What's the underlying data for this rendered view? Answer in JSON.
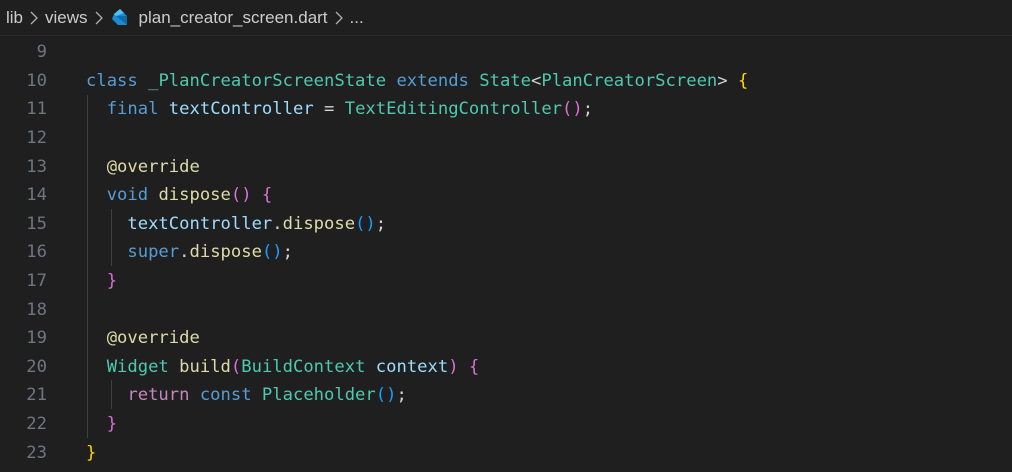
{
  "breadcrumb": {
    "items": [
      "lib",
      "views",
      "plan_creator_screen.dart",
      "..."
    ],
    "file_icon": "dart-icon"
  },
  "colors": {
    "background": "#1f1f1f",
    "line_number": "#6e7681",
    "keyword": "#569cd6",
    "type": "#4ec9b0",
    "variable": "#9cdcfe",
    "function": "#dcdcaa",
    "control": "#c586c0",
    "bracket_1": "#ffd700",
    "bracket_2": "#da70d6",
    "bracket_3": "#179fff"
  },
  "editor": {
    "lines": [
      {
        "number": "9",
        "tokens": []
      },
      {
        "number": "10",
        "tokens": [
          {
            "t": "class ",
            "c": "kw"
          },
          {
            "t": "_PlanCreatorScreenState ",
            "c": "ty"
          },
          {
            "t": "extends ",
            "c": "kw"
          },
          {
            "t": "State",
            "c": "ty"
          },
          {
            "t": "<",
            "c": "pl"
          },
          {
            "t": "PlanCreatorScreen",
            "c": "ty"
          },
          {
            "t": "> ",
            "c": "pl"
          },
          {
            "t": "{",
            "c": "b1"
          }
        ]
      },
      {
        "number": "11",
        "tokens": [
          {
            "t": "  final ",
            "c": "kw"
          },
          {
            "t": "textController",
            "c": "var"
          },
          {
            "t": " = ",
            "c": "pl"
          },
          {
            "t": "TextEditingController",
            "c": "ty"
          },
          {
            "t": "()",
            "c": "b2"
          },
          {
            "t": ";",
            "c": "pl"
          }
        ]
      },
      {
        "number": "12",
        "tokens": []
      },
      {
        "number": "13",
        "tokens": [
          {
            "t": "  @override",
            "c": "fn"
          }
        ]
      },
      {
        "number": "14",
        "tokens": [
          {
            "t": "  void ",
            "c": "kw"
          },
          {
            "t": "dispose",
            "c": "fn"
          },
          {
            "t": "() ",
            "c": "b2"
          },
          {
            "t": "{",
            "c": "b2"
          }
        ]
      },
      {
        "number": "15",
        "tokens": [
          {
            "t": "    textController",
            "c": "var"
          },
          {
            "t": ".",
            "c": "pl"
          },
          {
            "t": "dispose",
            "c": "fn"
          },
          {
            "t": "()",
            "c": "b3"
          },
          {
            "t": ";",
            "c": "pl"
          }
        ]
      },
      {
        "number": "16",
        "tokens": [
          {
            "t": "    super",
            "c": "kw"
          },
          {
            "t": ".",
            "c": "pl"
          },
          {
            "t": "dispose",
            "c": "fn"
          },
          {
            "t": "()",
            "c": "b3"
          },
          {
            "t": ";",
            "c": "pl"
          }
        ]
      },
      {
        "number": "17",
        "tokens": [
          {
            "t": "  }",
            "c": "b2"
          }
        ]
      },
      {
        "number": "18",
        "tokens": []
      },
      {
        "number": "19",
        "tokens": [
          {
            "t": "  @override",
            "c": "fn"
          }
        ]
      },
      {
        "number": "20",
        "tokens": [
          {
            "t": "  Widget ",
            "c": "ty"
          },
          {
            "t": "build",
            "c": "fn"
          },
          {
            "t": "(",
            "c": "b2"
          },
          {
            "t": "BuildContext ",
            "c": "ty"
          },
          {
            "t": "context",
            "c": "var"
          },
          {
            "t": ") ",
            "c": "b2"
          },
          {
            "t": "{",
            "c": "b2"
          }
        ]
      },
      {
        "number": "21",
        "tokens": [
          {
            "t": "    return ",
            "c": "ctl"
          },
          {
            "t": "const ",
            "c": "kw"
          },
          {
            "t": "Placeholder",
            "c": "ty"
          },
          {
            "t": "()",
            "c": "b3"
          },
          {
            "t": ";",
            "c": "pl"
          }
        ]
      },
      {
        "number": "22",
        "tokens": [
          {
            "t": "  }",
            "c": "b2"
          }
        ]
      },
      {
        "number": "23",
        "tokens": [
          {
            "t": "}",
            "c": "b1"
          }
        ]
      }
    ]
  }
}
